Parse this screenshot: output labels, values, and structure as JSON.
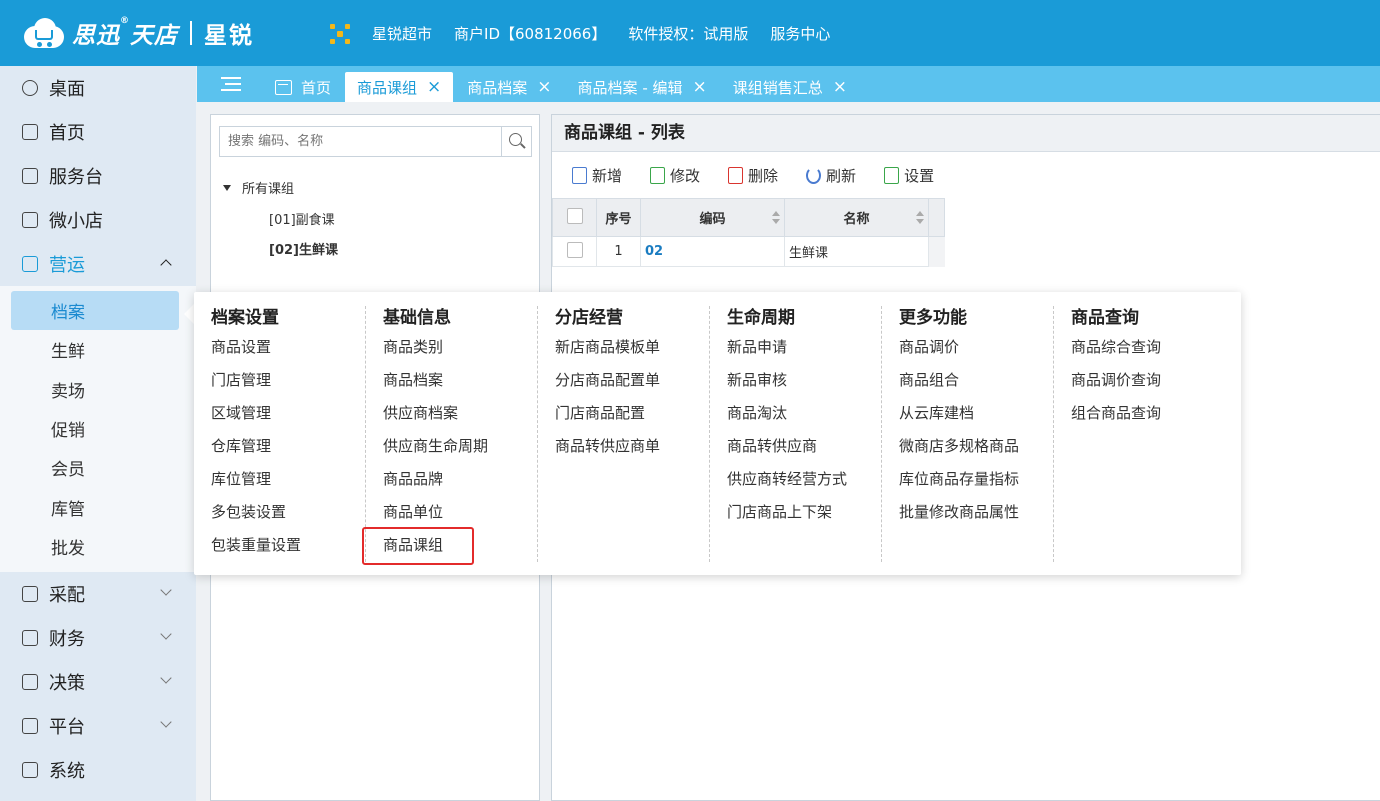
{
  "header": {
    "brand_name": "思迅",
    "brand_name2": "天店",
    "brand_sub": "星锐",
    "store": "星锐超市",
    "merchant_id": "商户ID【60812066】",
    "license": "软件授权：试用版",
    "service": "服务中心"
  },
  "sidebar": {
    "items": [
      {
        "label": "桌面",
        "icon": "user-circle-icon"
      },
      {
        "label": "首页",
        "icon": "store-icon"
      },
      {
        "label": "服务台",
        "icon": "service-desk-icon"
      },
      {
        "label": "微小店",
        "icon": "shop-icon"
      },
      {
        "label": "营运",
        "icon": "chart-icon"
      }
    ],
    "sub_items": [
      "档案",
      "生鲜",
      "卖场",
      "促销",
      "会员",
      "库管",
      "批发"
    ],
    "bottom_items": [
      {
        "label": "采配",
        "icon": "cart-icon"
      },
      {
        "label": "财务",
        "icon": "yen-icon"
      },
      {
        "label": "决策",
        "icon": "decision-icon"
      },
      {
        "label": "平台",
        "icon": "platform-icon"
      },
      {
        "label": "系统",
        "icon": "system-icon"
      }
    ]
  },
  "tabs": [
    {
      "label": "首页"
    },
    {
      "label": "商品课组",
      "close": "×"
    },
    {
      "label": "商品档案",
      "close": "×"
    },
    {
      "label": "商品档案 - 编辑",
      "close": "×"
    },
    {
      "label": "课组销售汇总",
      "close": "×"
    }
  ],
  "tree": {
    "search_placeholder": "搜索 编码、名称",
    "root": "所有课组",
    "nodes": [
      "[01]副食课",
      "[02]生鲜课"
    ]
  },
  "list": {
    "title": "商品课组 - 列表",
    "toolbar": [
      "新增",
      "修改",
      "删除",
      "刷新",
      "设置"
    ],
    "columns": [
      "序号",
      "编码",
      "名称"
    ],
    "rows": [
      {
        "index": "1",
        "code": "02",
        "name": "生鲜课"
      }
    ]
  },
  "mega_menu": {
    "columns": [
      {
        "title": "档案设置",
        "items": [
          "商品设置",
          "门店管理",
          "区域管理",
          "仓库管理",
          "库位管理",
          "多包装设置",
          "包装重量设置"
        ]
      },
      {
        "title": "基础信息",
        "items": [
          "商品类别",
          "商品档案",
          "供应商档案",
          "供应商生命周期",
          "商品品牌",
          "商品单位",
          "商品课组"
        ]
      },
      {
        "title": "分店经营",
        "items": [
          "新店商品模板单",
          "分店商品配置单",
          "门店商品配置",
          "商品转供应商单"
        ]
      },
      {
        "title": "生命周期",
        "items": [
          "新品申请",
          "新品审核",
          "商品淘汰",
          "商品转供应商",
          "供应商转经营方式",
          "门店商品上下架"
        ]
      },
      {
        "title": "更多功能",
        "items": [
          "商品调价",
          "商品组合",
          "从云库建档",
          "微商店多规格商品",
          "库位商品存量指标",
          "批量修改商品属性"
        ]
      },
      {
        "title": "商品查询",
        "items": [
          "商品综合查询",
          "商品调价查询",
          "组合商品查询"
        ]
      }
    ]
  }
}
